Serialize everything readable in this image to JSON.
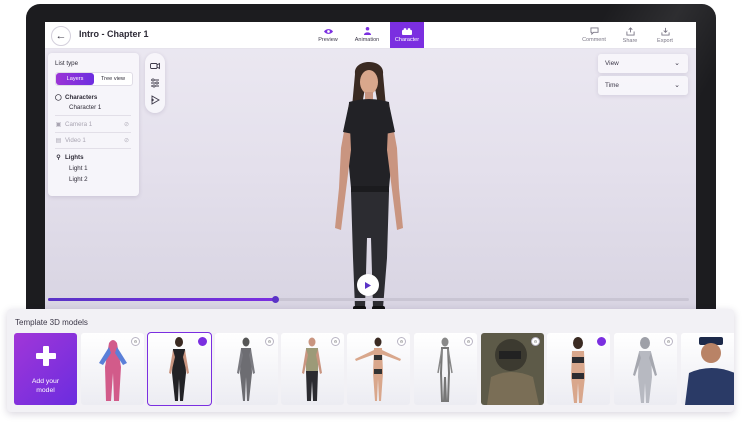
{
  "header": {
    "title": "Intro - Chapter 1",
    "tabs": [
      {
        "label": "Preview",
        "icon": "eye-icon"
      },
      {
        "label": "Animation",
        "icon": "person-run-icon"
      },
      {
        "label": "Character",
        "icon": "character-icon",
        "active": true
      }
    ],
    "actions": [
      {
        "label": "Comment",
        "icon": "comment-icon"
      },
      {
        "label": "Share",
        "icon": "share-icon"
      },
      {
        "label": "Export",
        "icon": "download-icon"
      }
    ]
  },
  "panel": {
    "title": "List type",
    "segments": [
      "Layers",
      "Tree view"
    ],
    "active_segment": "Layers",
    "characters_label": "Characters",
    "character_items": [
      "Character 1"
    ],
    "camera_label": "Camera 1",
    "video_label": "Video 1",
    "lights_label": "Lights",
    "light_items": [
      "Light 1",
      "Light 2"
    ]
  },
  "dropdowns": [
    {
      "label": "View"
    },
    {
      "label": "Time"
    }
  ],
  "timeline": {
    "progress": 0.355
  },
  "templates": {
    "title": "Template 3D models",
    "add_label_1": "Add your",
    "add_label_2": "model",
    "selected_index": 1
  },
  "colors": {
    "accent": "#7b2fe0",
    "accent_gradient_start": "#a136d8",
    "bezel": "#1c1c1f"
  }
}
